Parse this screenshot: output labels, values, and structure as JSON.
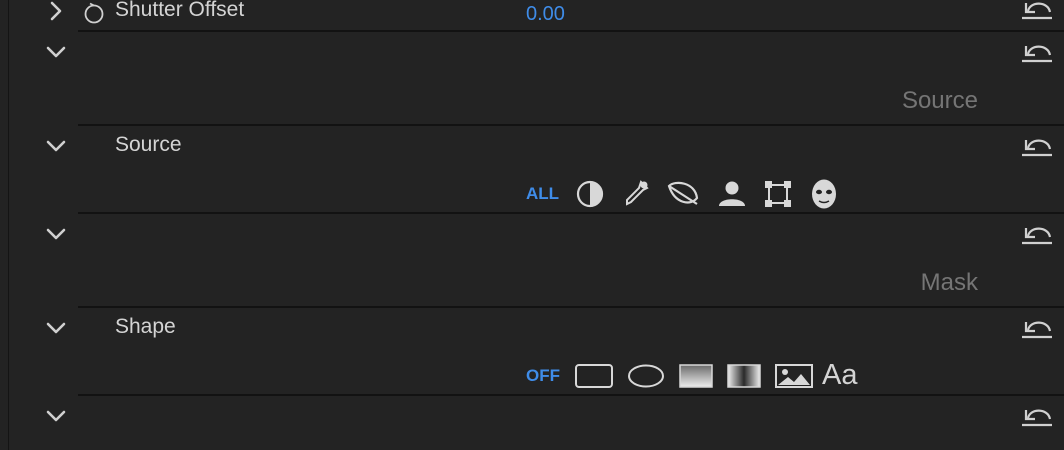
{
  "shutter": {
    "label": "Shutter Offset",
    "value": "0.00"
  },
  "sections": {
    "source_header": "Source",
    "mask_header": "Mask"
  },
  "source": {
    "label": "Source",
    "mode": "ALL"
  },
  "shape": {
    "label": "Shape",
    "mode": "OFF",
    "text_tool": "Aa"
  },
  "colors": {
    "accent": "#3f8ce8",
    "bg": "#232323",
    "divider": "#121212"
  }
}
